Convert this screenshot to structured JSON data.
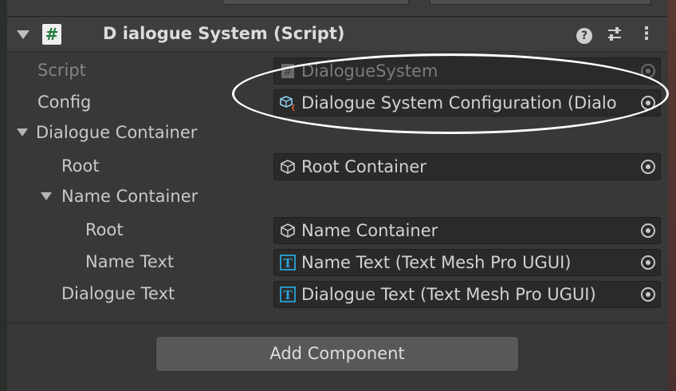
{
  "component": {
    "title": "D ialogue System (Script)",
    "icon": "script-hash-icon",
    "header_icons": [
      "help-icon",
      "preset-sliders-icon",
      "kebab-menu-icon"
    ]
  },
  "fields": {
    "script": {
      "label": "Script",
      "value": "DialogueSystem"
    },
    "config": {
      "label": "Config",
      "value": "Dialogue System Configuration (Dialo"
    }
  },
  "dialogue_container": {
    "label": "Dialogue Container",
    "root": {
      "label": "Root",
      "value": "Root Container"
    },
    "name_container": {
      "label": "Name Container",
      "root": {
        "label": "Root",
        "value": "Name Container"
      },
      "name_text": {
        "label": "Name Text",
        "value": "Name Text (Text Mesh Pro UGUI)"
      }
    },
    "dialogue_text": {
      "label": "Dialogue Text",
      "value": "Dialogue Text (Text Mesh Pro UGUI)"
    }
  },
  "add_component": {
    "label": "Add Component"
  },
  "colors": {
    "panel": "#383838",
    "field": "#2a2a2a",
    "text_mesh_icon": "#2aa3d6",
    "script_icon": "#1f7a3a",
    "annotation": "#ffffff"
  }
}
